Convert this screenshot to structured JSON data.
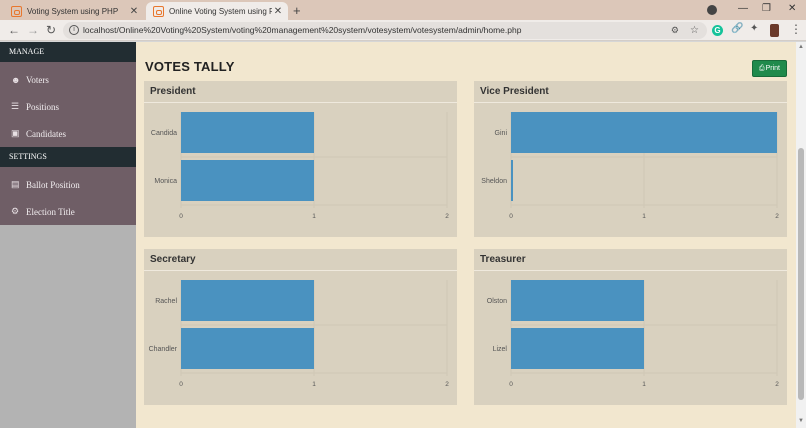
{
  "browser": {
    "tabs": [
      {
        "title": "Voting System using PHP",
        "active": false
      },
      {
        "title": "Online Voting System using PHP",
        "active": true
      }
    ],
    "new_tab": "+",
    "close": "✕",
    "url": "localhost/Online%20Voting%20System/voting%20management%20system/votesystem/votesystem/admin/home.php",
    "icons": [
      "back-icon",
      "forward-icon",
      "reload-icon",
      "info-icon",
      "key-icon",
      "star-icon",
      "grammarly-icon",
      "link-icon",
      "puzzle-icon",
      "menu-icon"
    ]
  },
  "sidebar": {
    "manage_header": "MANAGE",
    "manage_items": [
      {
        "label": "Voters",
        "icon": "users-icon"
      },
      {
        "label": "Positions",
        "icon": "list-icon"
      },
      {
        "label": "Candidates",
        "icon": "id-card-icon"
      }
    ],
    "settings_header": "SETTINGS",
    "settings_items": [
      {
        "label": "Ballot Position",
        "icon": "file-icon"
      },
      {
        "label": "Election Title",
        "icon": "cogs-icon"
      }
    ]
  },
  "main": {
    "title": "VOTES TALLY",
    "print_label": "Print",
    "print_icon": "print-icon"
  },
  "colors": {
    "bar": "#4a92c0",
    "panel": "#d9d1bf",
    "content_bg": "#f2e7cf",
    "sidebar_bg": "#6f5e66",
    "sidebar_header": "#222d32",
    "print_button": "#1f8a4c"
  },
  "chart_data": [
    {
      "type": "bar",
      "orientation": "horizontal",
      "title": "President",
      "categories": [
        "Candida",
        "Monica"
      ],
      "values": [
        1,
        1
      ],
      "xlim": [
        0,
        2
      ],
      "ticks": [
        "0",
        "1",
        "2"
      ]
    },
    {
      "type": "bar",
      "orientation": "horizontal",
      "title": "Vice President",
      "categories": [
        "Gini",
        "Sheldon"
      ],
      "values": [
        2,
        0
      ],
      "xlim": [
        0,
        2
      ],
      "ticks": [
        "0",
        "1",
        "2"
      ]
    },
    {
      "type": "bar",
      "orientation": "horizontal",
      "title": "Secretary",
      "categories": [
        "Rachel",
        "Chandler"
      ],
      "values": [
        1,
        1
      ],
      "xlim": [
        0,
        2
      ],
      "ticks": [
        "0",
        "1",
        "2"
      ]
    },
    {
      "type": "bar",
      "orientation": "horizontal",
      "title": "Treasurer",
      "categories": [
        "Olston",
        "Lizel"
      ],
      "values": [
        1,
        1
      ],
      "xlim": [
        0,
        2
      ],
      "ticks": [
        "0",
        "1",
        "2"
      ]
    }
  ]
}
